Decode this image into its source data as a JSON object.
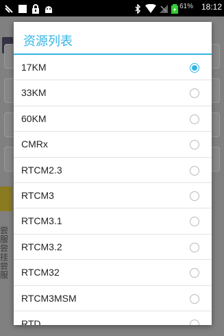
{
  "status_bar": {
    "icons": [
      "usb-debug-icon",
      "notification-icon",
      "lock-icon",
      "android-icon",
      "bluetooth-icon",
      "wifi-icon",
      "no-signal-icon",
      "battery-icon"
    ],
    "battery_percent": "61%",
    "time": "18:12"
  },
  "background": {
    "side_text": "尝服尝挂尝服"
  },
  "dialog": {
    "title": "资源列表",
    "accent_color": "#33b5e5",
    "items": [
      {
        "label": "17KM",
        "selected": true
      },
      {
        "label": "33KM",
        "selected": false
      },
      {
        "label": "60KM",
        "selected": false
      },
      {
        "label": "CMRx",
        "selected": false
      },
      {
        "label": "RTCM2.3",
        "selected": false
      },
      {
        "label": "RTCM3",
        "selected": false
      },
      {
        "label": "RTCM3.1",
        "selected": false
      },
      {
        "label": "RTCM3.2",
        "selected": false
      },
      {
        "label": "RTCM32",
        "selected": false
      },
      {
        "label": "RTCM3MSM",
        "selected": false
      },
      {
        "label": "RTD",
        "selected": false
      }
    ]
  }
}
